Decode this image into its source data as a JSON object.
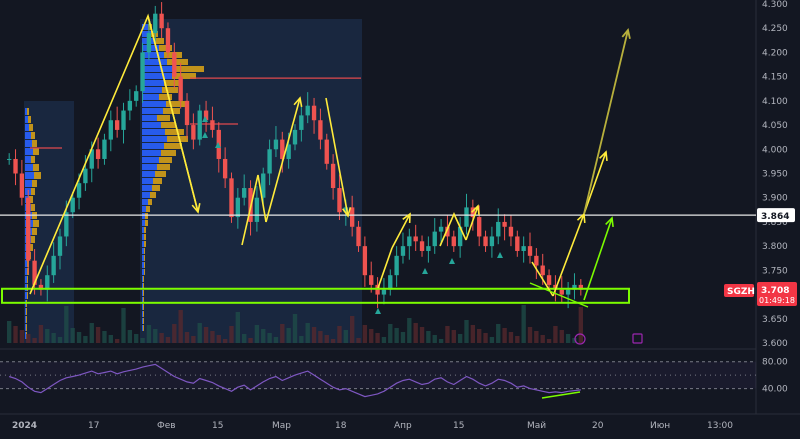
{
  "chart_data": {
    "type": "candlestick",
    "ticker": "SGZH",
    "price_label": "3.708",
    "countdown": "01:49:18",
    "level_label": "3.864",
    "y_ticks": [
      "4.300",
      "4.250",
      "4.200",
      "4.150",
      "4.100",
      "4.050",
      "4.000",
      "3.950",
      "3.900",
      "3.850",
      "3.800",
      "3.750",
      "3.700",
      "3.650",
      "3.600"
    ],
    "y_range": [
      3.6,
      4.3
    ],
    "x_ticks": [
      "2024",
      "17",
      "Фев",
      "15",
      "Мар",
      "18",
      "Апр",
      "15",
      "Май",
      "20",
      "Июн",
      "13:00"
    ],
    "rsi_ticks": [
      "80.00",
      "40.00"
    ],
    "rsi_range": [
      20,
      90
    ],
    "support_zone": [
      3.683,
      3.712
    ],
    "horizontal_level": 3.864,
    "volume_profile_poc": 4.147,
    "close_series": [
      3.98,
      3.95,
      3.9,
      3.77,
      3.72,
      3.71,
      3.74,
      3.78,
      3.82,
      3.87,
      3.9,
      3.93,
      3.96,
      4.0,
      3.98,
      4.02,
      4.06,
      4.04,
      4.08,
      4.1,
      4.12,
      4.2,
      4.24,
      4.28,
      4.25,
      4.2,
      4.15,
      4.1,
      4.05,
      4.02,
      4.08,
      4.06,
      4.04,
      3.98,
      3.94,
      3.86,
      3.9,
      3.92,
      3.85,
      3.9,
      3.95,
      4.0,
      4.02,
      3.98,
      4.01,
      4.04,
      4.07,
      4.09,
      4.06,
      4.02,
      3.97,
      3.92,
      3.87,
      3.88,
      3.84,
      3.8,
      3.74,
      3.72,
      3.7,
      3.71,
      3.74,
      3.78,
      3.8,
      3.82,
      3.81,
      3.79,
      3.8,
      3.83,
      3.84,
      3.82,
      3.8,
      3.84,
      3.88,
      3.86,
      3.82,
      3.8,
      3.82,
      3.85,
      3.84,
      3.82,
      3.79,
      3.8,
      3.78,
      3.76,
      3.74,
      3.72,
      3.71,
      3.7,
      3.71,
      3.72,
      3.71
    ],
    "rsi_series": [
      58,
      55,
      50,
      42,
      36,
      34,
      40,
      46,
      52,
      56,
      58,
      60,
      63,
      66,
      62,
      64,
      66,
      62,
      65,
      67,
      69,
      72,
      74,
      76,
      70,
      64,
      58,
      54,
      50,
      48,
      55,
      52,
      49,
      44,
      40,
      36,
      42,
      45,
      38,
      44,
      50,
      55,
      58,
      52,
      56,
      60,
      63,
      66,
      60,
      54,
      48,
      42,
      38,
      40,
      36,
      32,
      28,
      30,
      32,
      36,
      42,
      48,
      52,
      54,
      50,
      46,
      48,
      54,
      56,
      50,
      46,
      52,
      58,
      54,
      48,
      44,
      48,
      54,
      52,
      48,
      42,
      44,
      40,
      38,
      36,
      34,
      35,
      34,
      36,
      37,
      38
    ]
  }
}
